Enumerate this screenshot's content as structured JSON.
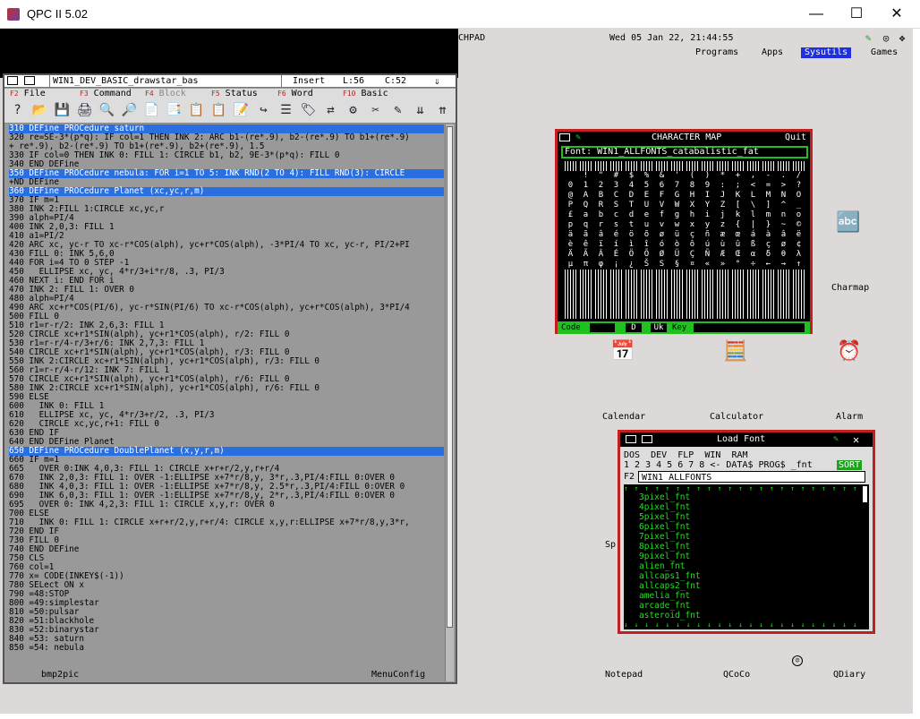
{
  "window": {
    "title": "QPC II 5.02",
    "controls": [
      "—",
      "☐",
      "✕"
    ]
  },
  "topbar": {
    "fragment": "CHPAD",
    "clock": "Wed 05 Jan 22, 21:44:55",
    "menus": [
      "Programs",
      "Apps",
      "Sysutils",
      "Games"
    ],
    "selected_menu": "Sysutils"
  },
  "editor": {
    "filename": "WIN1_DEV_BASIC_drawstar_bas",
    "mode": "Insert",
    "line": "L:56",
    "col": "C:52",
    "menu": [
      {
        "key": "F2",
        "label": "File"
      },
      {
        "key": "F3",
        "label": "Command"
      },
      {
        "key": "F4",
        "label": "Block"
      },
      {
        "key": "F5",
        "label": "Status"
      },
      {
        "key": "F6",
        "label": "Word"
      },
      {
        "key": "F10",
        "label": "Basic"
      }
    ],
    "tools": [
      "?",
      "📂",
      "💾",
      "🖨",
      "🔍",
      "🔎",
      "📄",
      "📑",
      "📋",
      "📋",
      "📝",
      "↪",
      "☰",
      "🏷",
      "⇄",
      "⚙",
      "✂",
      "✎",
      "⇊",
      "⇈"
    ],
    "lines": [
      {
        "t": "310 DEFine PROCedure saturn",
        "h": true
      },
      {
        "t": "320 re=SE-3*(p*q): IF col=1 THEN INK 2: ARC b1-(re*.9), b2-(re*.9) TO b1+(re*.9)",
        "h": false
      },
      {
        "t": "+ re*.9), b2-(re*.9) TO b1+(re*.9), b2+(re*.9), 1.5",
        "h": false
      },
      {
        "t": "330 IF col=0 THEN INK 0: FILL 1: CIRCLE b1, b2, 9E-3*(p*q): FILL 0",
        "h": false
      },
      {
        "t": "340 END DEFine",
        "h": false
      },
      {
        "t": "350 DEFine PROCedure nebula: FOR i=1 TO 5: INK RND(2 TO 4): FILL RND(3): CIRCLE",
        "h": true
      },
      {
        "t": "+ND DEFine",
        "h": false
      },
      {
        "t": "360 DEFine PROCedure Planet (xc,yc,r,m)",
        "h": true
      },
      {
        "t": "370 IF m=1",
        "h": false
      },
      {
        "t": "380 INK 2:FILL 1:CIRCLE xc,yc,r",
        "h": false
      },
      {
        "t": "390 alph=PI/4",
        "h": false
      },
      {
        "t": "400 INK 2,0,3: FILL 1",
        "h": false
      },
      {
        "t": "410 a1=PI/2",
        "h": false
      },
      {
        "t": "420 ARC xc, yc-r TO xc-r*COS(alph), yc+r*COS(alph), -3*PI/4 TO xc, yc-r, PI/2+PI",
        "h": false
      },
      {
        "t": "430 FILL 0: INK 5,6,0",
        "h": false
      },
      {
        "t": "440 FOR i=4 TO 0 STEP -1",
        "h": false
      },
      {
        "t": "450   ELLIPSE xc, yc, 4*r/3+i*r/8, .3, PI/3",
        "h": false
      },
      {
        "t": "460 NEXT i: END FOR i",
        "h": false
      },
      {
        "t": "470 INK 2: FILL 1: OVER 0",
        "h": false
      },
      {
        "t": "480 alph=PI/4",
        "h": false
      },
      {
        "t": "490 ARC xc+r*COS(PI/6), yc-r*SIN(PI/6) TO xc-r*COS(alph), yc+r*COS(alph), 3*PI/4",
        "h": false
      },
      {
        "t": "500 FILL 0",
        "h": false
      },
      {
        "t": "510 r1=r-r/2: INK 2,6,3: FILL 1",
        "h": false
      },
      {
        "t": "520 CIRCLE xc+r1*SIN(alph), yc+r1*COS(alph), r/2: FILL 0",
        "h": false
      },
      {
        "t": "530 r1=r-r/4-r/3+r/6: INK 2,7,3: FILL 1",
        "h": false
      },
      {
        "t": "540 CIRCLE xc+r1*SIN(alph), yc+r1*COS(alph), r/3: FILL 0",
        "h": false
      },
      {
        "t": "550 INK 2:CIRCLE xc+r1*SIN(alph), yc+r1*COS(alph), r/3: FILL 0",
        "h": false
      },
      {
        "t": "560 r1=r-r/4-r/12: INK 7: FILL 1",
        "h": false
      },
      {
        "t": "570 CIRCLE xc+r1*SIN(alph), yc+r1*COS(alph), r/6: FILL 0",
        "h": false
      },
      {
        "t": "580 INK 2:CIRCLE xc+r1*SIN(alph), yc+r1*COS(alph), r/6: FILL 0",
        "h": false
      },
      {
        "t": "590 ELSE",
        "h": false
      },
      {
        "t": "600   INK 0: FILL 1",
        "h": false
      },
      {
        "t": "610   ELLIPSE xc, yc, 4*r/3+r/2, .3, PI/3",
        "h": false
      },
      {
        "t": "620   CIRCLE xc,yc,r+1: FILL 0",
        "h": false
      },
      {
        "t": "630 END IF",
        "h": false
      },
      {
        "t": "640 END DEFine Planet",
        "h": false
      },
      {
        "t": "650 DEFine PROCedure DoublePlanet (x,y,r,m)",
        "h": true
      },
      {
        "t": "660 IF m=1",
        "h": false
      },
      {
        "t": "665   OVER 0:INK 4,0,3: FILL 1: CIRCLE x+r+r/2,y,r+r/4",
        "h": false
      },
      {
        "t": "670   INK 2,0,3: FILL 1: OVER -1:ELLIPSE x+7*r/8,y, 3*r,.3,PI/4:FILL 0:OVER 0",
        "h": false
      },
      {
        "t": "680   INK 4,0,3: FILL 1: OVER -1:ELLIPSE x+7*r/8,y, 2.5*r,.3,PI/4:FILL 0:OVER 0",
        "h": false
      },
      {
        "t": "690   INK 6,0,3: FILL 1: OVER -1:ELLIPSE x+7*r/8,y, 2*r,.3,PI/4:FILL 0:OVER 0",
        "h": false
      },
      {
        "t": "695   OVER 0: INK 4,2,3: FILL 1: CIRCLE x,y,r: OVER 0",
        "h": false
      },
      {
        "t": "700 ELSE",
        "h": false
      },
      {
        "t": "710   INK 0: FILL 1: CIRCLE x+r+r/2,y,r+r/4: CIRCLE x,y,r:ELLIPSE x+7*r/8,y,3*r,",
        "h": false
      },
      {
        "t": "720 END IF",
        "h": false
      },
      {
        "t": "730 FILL 0",
        "h": false
      },
      {
        "t": "740 END DEFine",
        "h": false
      },
      {
        "t": "750 CLS",
        "h": false
      },
      {
        "t": "760 col=1",
        "h": false
      },
      {
        "t": "770 x= CODE(INKEY$(-1))",
        "h": false
      },
      {
        "t": "780 SELect ON x",
        "h": false
      },
      {
        "t": "790 =48:STOP",
        "h": false
      },
      {
        "t": "800 =49:simplestar",
        "h": false
      },
      {
        "t": "810 =50:pulsar",
        "h": false
      },
      {
        "t": "820 =51:blackhole",
        "h": false
      },
      {
        "t": "830 =52:binarystar",
        "h": false
      },
      {
        "t": "840 =53: saturn",
        "h": false
      },
      {
        "t": "850 =54: nebula",
        "h": false
      }
    ]
  },
  "charmap": {
    "title": "CHARACTER MAP",
    "quit": "Quit",
    "font_label": "Font:",
    "font_value": "WIN1_ALLFONTS_catabalistic_fat",
    "code_label": "Code",
    "d_label": "D",
    "uk_label": "Uk",
    "key_label": "Key",
    "rows": [
      {
        "stripe": true,
        "c": ""
      },
      {
        "stripe": false,
        "c": " !\"#$%&'()*+,-./"
      },
      {
        "stripe": false,
        "c": "0123456789:;<=>?"
      },
      {
        "stripe": false,
        "c": "@ABCDEFGHIJKLMNO"
      },
      {
        "stripe": false,
        "c": "PQRSTUVWXYZ[\\]^_"
      },
      {
        "stripe": false,
        "c": "£abcdefghijklmno"
      },
      {
        "stripe": false,
        "c": "pqrstuvwxyz{|}~©"
      },
      {
        "stripe": false,
        "c": "äãâéöõøüçñæœáàâë"
      },
      {
        "stripe": false,
        "c": "èêïíìîóòôúùûßçø¢"
      },
      {
        "stripe": false,
        "c": "ÄÃÂÉÖÕØÜÇÑÆŒαδθλ"
      },
      {
        "stripe": false,
        "c": "μπφ¡¿ŠS§¤«»°÷←→↑↓"
      },
      {
        "stripe": true,
        "c": ""
      },
      {
        "stripe": true,
        "c": ""
      },
      {
        "stripe": true,
        "c": ""
      },
      {
        "stripe": true,
        "c": ""
      },
      {
        "stripe": true,
        "c": ""
      }
    ]
  },
  "loadfont": {
    "title": "Load Font",
    "devs": [
      "DOS",
      "DEV",
      "FLP",
      "WIN",
      "RAM"
    ],
    "nums": "1 2 3 4 5 6 7 8  <-  DATA$ PROG$   _fnt",
    "sort": "SORT",
    "input_key": "F2",
    "input_value": "WIN1_ALLFONTS_",
    "files": [
      "3pixel_fnt",
      "4pixel_fnt",
      "5pixel_fnt",
      "6pixel_fnt",
      "7pixel_fnt",
      "8pixel_fnt",
      "9pixel_fnt",
      "alien_fnt",
      "allcaps1_fnt",
      "allcaps2_fnt",
      "amelia_fnt",
      "arcade_fnt",
      "asteroid_fnt"
    ]
  },
  "desktop": {
    "icons": [
      {
        "name": "Charmap",
        "glyph": "🔤"
      },
      {
        "name": "Calendar",
        "glyph": "📅"
      },
      {
        "name": "Calculator",
        "glyph": "🧮"
      },
      {
        "name": "Alarm",
        "glyph": "⏰"
      },
      {
        "name": "bmp2pic",
        "glyph": ""
      },
      {
        "name": "MenuConfig",
        "glyph": ""
      },
      {
        "name": "Notepad",
        "glyph": ""
      },
      {
        "name": "QCoCo",
        "glyph": ""
      },
      {
        "name": "QDiary",
        "glyph": ""
      }
    ],
    "partial_label": "Sp"
  },
  "colors": {
    "highlight": "#2a6fe0",
    "accent_red": "#c02020",
    "accent_green": "#20c020"
  }
}
